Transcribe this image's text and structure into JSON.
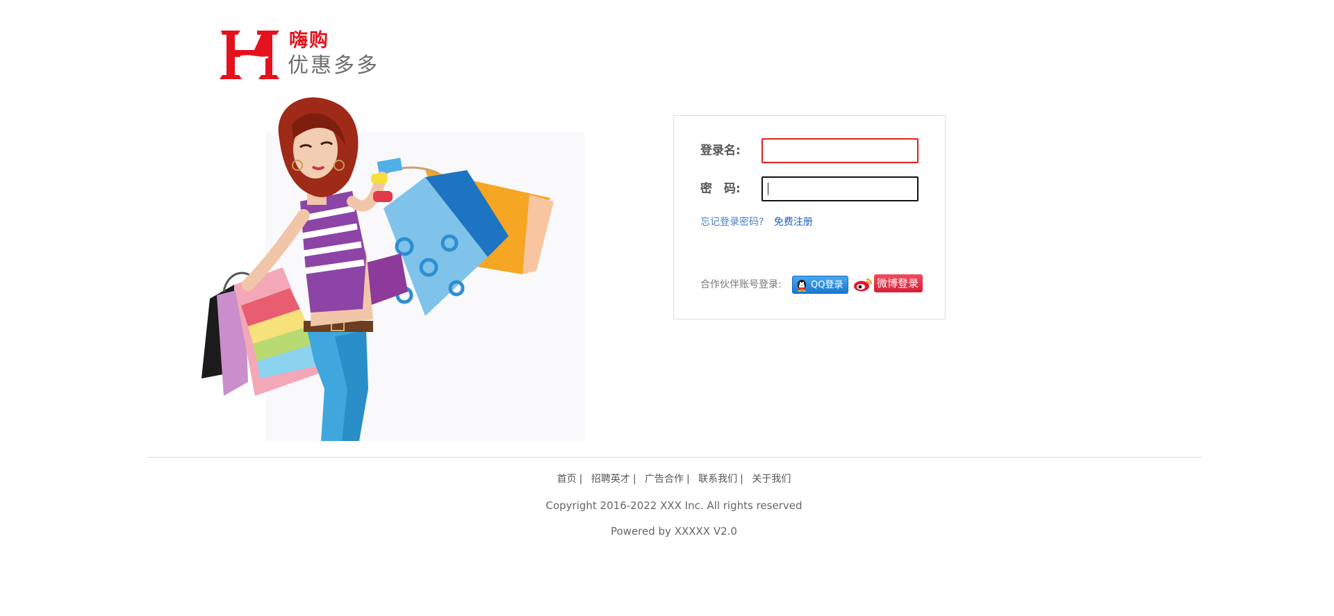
{
  "brand": {
    "logo_letter": "H",
    "name": "嗨购",
    "slogan": "优惠多多",
    "accent_color": "#e3121d"
  },
  "hero": {
    "icon": "shopping-girl-illustration"
  },
  "login": {
    "username_label": "登录名:",
    "username_value": "",
    "password_label": "密　码:",
    "password_value": "",
    "forgot_link": "忘记登录密码?",
    "register_link": "免费注册",
    "partner_label": "合作伙伴账号登录:",
    "qq_button": "QQ登录",
    "weibo_button": "微博登录",
    "error_border_color": "#e02020"
  },
  "footer": {
    "nav": [
      "首页",
      "招聘英才",
      "广告合作",
      "联系我们",
      "关于我们"
    ],
    "separator": "|",
    "copyright": "Copyright 2016-2022 XXX Inc. All rights reserved",
    "powered": "Powered by XXXXX V2.0"
  }
}
